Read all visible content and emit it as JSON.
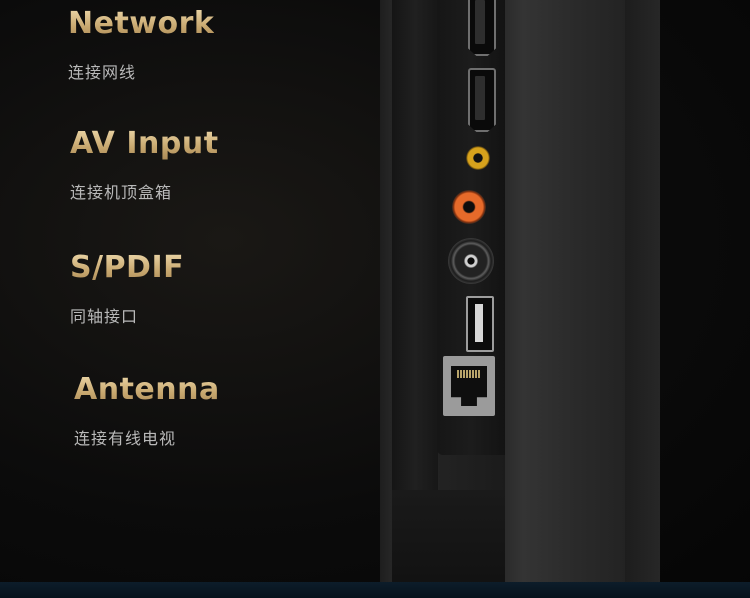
{
  "features": [
    {
      "title": "Network",
      "subtitle": "连接网线"
    },
    {
      "title": "AV Input",
      "subtitle": "连接机顶盒箱"
    },
    {
      "title": "S/PDIF",
      "subtitle": "同轴接口"
    },
    {
      "title": "Antenna",
      "subtitle": "连接有线电视"
    }
  ],
  "colors": {
    "title_gold": "#d8bf8e",
    "subtitle_gray": "#b9b9b9",
    "background": "#0b0b0b"
  },
  "icons": [
    "hdmi-port-icon",
    "hdmi-port-icon",
    "rca-yellow-port-icon",
    "rca-red-port-icon",
    "coax-port-icon",
    "usb-port-icon",
    "ethernet-port-icon"
  ]
}
